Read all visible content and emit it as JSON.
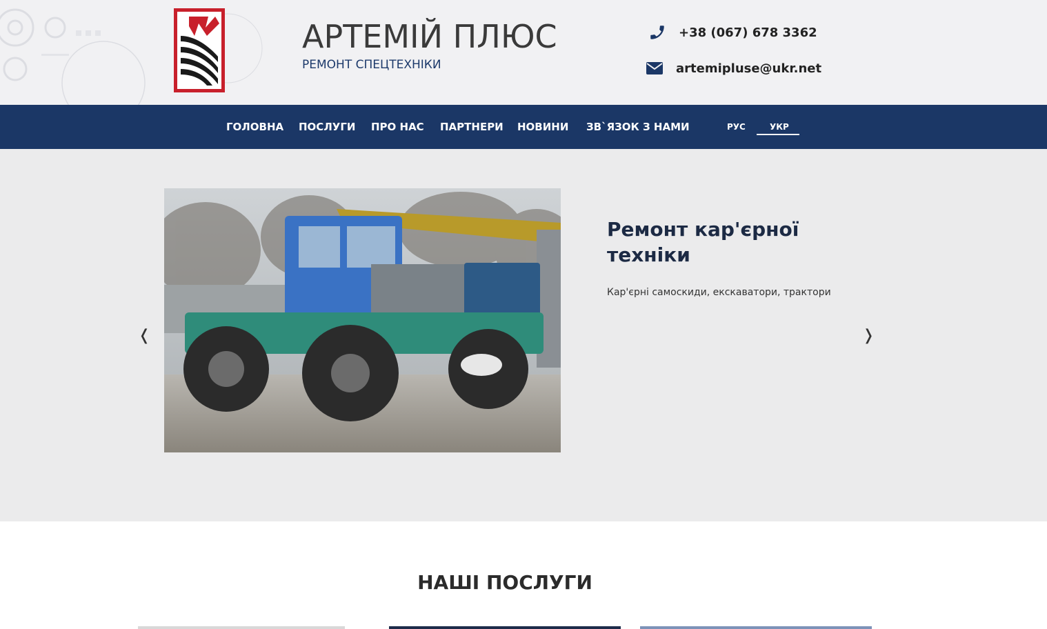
{
  "brand": {
    "title": "АРТЕМІЙ ПЛЮС",
    "subtitle": "РЕМОНТ СПЕЦТЕХНІКИ",
    "logo_icon": "company-logo-icon"
  },
  "contacts": {
    "phone": "+38 (067) 678 3362",
    "email": "artemipluse@ukr.net",
    "phone_icon": "phone-icon",
    "email_icon": "envelope-icon"
  },
  "nav": {
    "items": [
      {
        "label": "ГОЛОВНА"
      },
      {
        "label": "ПОСЛУГИ"
      },
      {
        "label": "ПРО НАС"
      },
      {
        "label": "ПАРТНЕРИ"
      },
      {
        "label": "НОВИНИ"
      },
      {
        "label": "ЗВ`ЯЗОК З НАМИ"
      }
    ],
    "languages": [
      {
        "label": "РУС",
        "active": false
      },
      {
        "label": "УКР",
        "active": true
      }
    ]
  },
  "slider": {
    "title": "Ремонт кар'єрної техніки",
    "text": "Кар'єрні самоскиди, екскаватори, трактори",
    "prev": "❬",
    "next": "❭",
    "image": "tractor-photo"
  },
  "services": {
    "title": "НАШІ ПОСЛУГИ"
  },
  "colors": {
    "nav_bg": "#1b3766",
    "logo_red": "#c8202b",
    "accent_blue": "#1d3a6b"
  }
}
